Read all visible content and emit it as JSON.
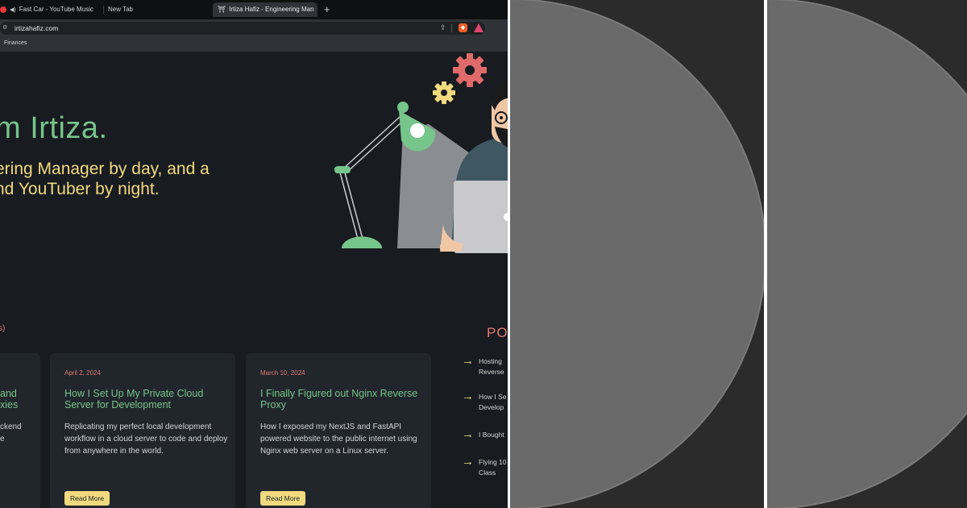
{
  "browser": {
    "tabs": [
      {
        "label": "Fast Car - YouTube Music",
        "active": false
      },
      {
        "label": "New Tab",
        "active": false
      },
      {
        "label": "Irtiza Hafiz - Engineering Man",
        "active": true
      }
    ],
    "new_tab": "+",
    "url": "irtizahafiz.com",
    "bookmark": "Finances"
  },
  "hero": {
    "title": "m Irtiza.",
    "line1": "ering Manager by day, and a",
    "line2": "nd YouTuber by night."
  },
  "recent_label": "s)",
  "popular_heading": "PO",
  "cards": [
    {
      "title_lines": [
        "and",
        "xies"
      ],
      "excerpt_lines": [
        "ckend",
        "e"
      ]
    },
    {
      "date": "April 2, 2024",
      "title": "How I Set Up My Private Cloud Server for Development",
      "excerpt": "Replicating my perfect local development workflow in a cloud server to code and deploy from anywhere in the world.",
      "button": "Read More"
    },
    {
      "date": "March 10, 2024",
      "title": "I Finally Figured out Nginx Reverse Proxy",
      "excerpt": "How I exposed my NextJS and FastAPI powered website to the public internet using Nginx web server on a Linux server.",
      "button": "Read More"
    }
  ],
  "popular": [
    {
      "lines": [
        "Hosting",
        "Reverse"
      ]
    },
    {
      "lines": [
        "How I Se",
        "Develop"
      ]
    },
    {
      "lines": [
        "I Bought"
      ]
    },
    {
      "lines": [
        "Flying 10",
        "Class"
      ]
    }
  ],
  "colors": {
    "background": "#181b20",
    "card": "#21252c",
    "accent_green": "#76c58a",
    "accent_yellow": "#f1da7e",
    "accent_red": "#e07b6f",
    "panel_circle": "#6a6a6a"
  },
  "icons": {
    "arrow": "→",
    "brave": "brave-lion-icon",
    "rewards": "triangle-icon",
    "share": "share-icon"
  }
}
